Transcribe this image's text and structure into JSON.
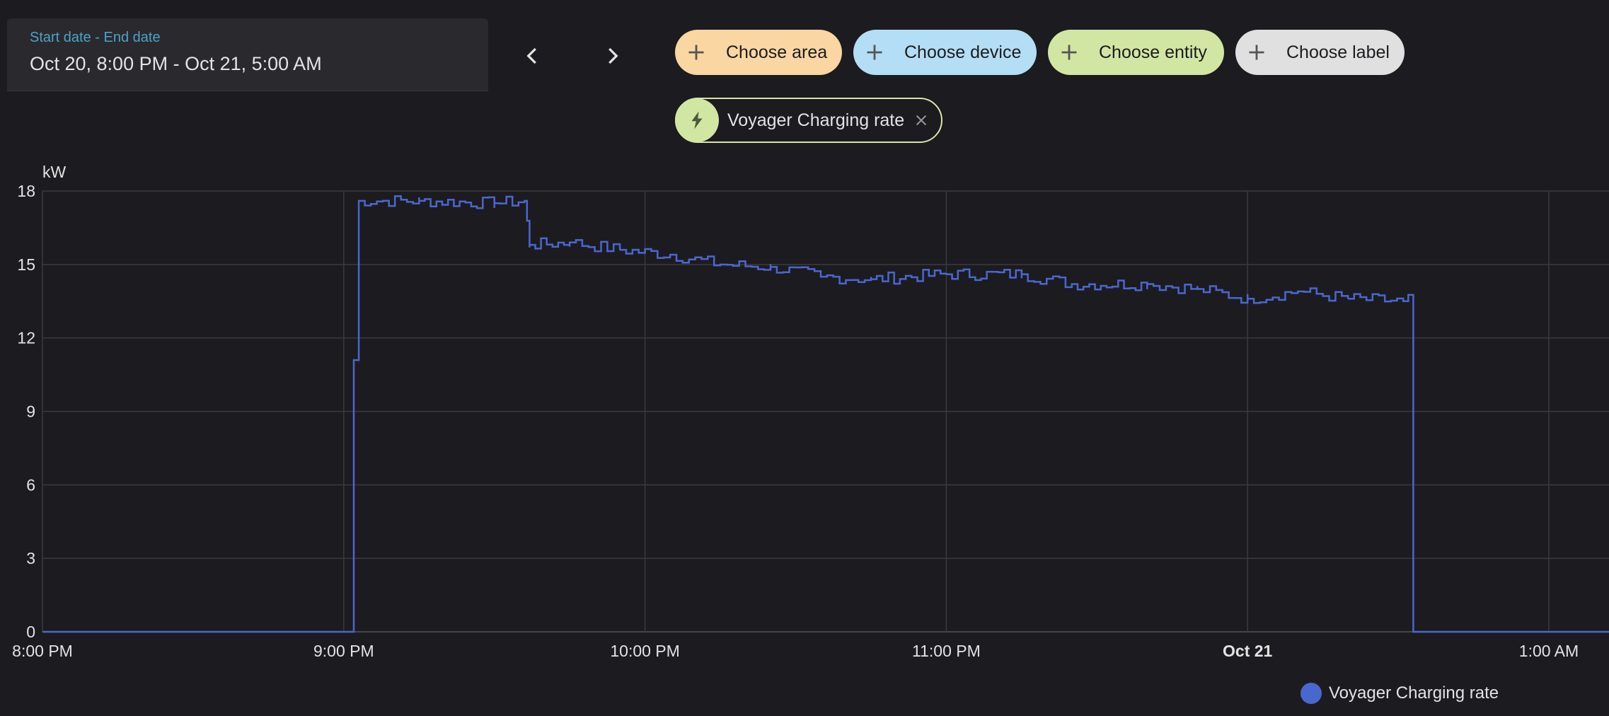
{
  "date_range": {
    "label": "Start date - End date",
    "value": "Oct 20, 8:00 PM - Oct 21, 5:00 AM"
  },
  "filters": {
    "area": {
      "label": "Choose area",
      "color": "#f9d6a2"
    },
    "device": {
      "label": "Choose device",
      "color": "#b3def5"
    },
    "entity": {
      "label": "Choose entity",
      "color": "#d2e6a3"
    },
    "label": {
      "label": "Choose label",
      "color": "#e0e0e0"
    }
  },
  "selected_entity": {
    "label": "Voyager Charging rate",
    "icon": "lightning-bolt-icon"
  },
  "legend": {
    "label": "Voyager Charging rate",
    "color": "#4a67cf"
  },
  "chart_data": {
    "type": "line",
    "step": true,
    "ylabel": "kW",
    "ylim": [
      0,
      18
    ],
    "yticks": [
      0,
      3,
      6,
      9,
      12,
      15,
      18
    ],
    "xlim_hours": [
      "8:00 PM",
      "1:12 AM"
    ],
    "xticks": [
      "8:00 PM",
      "9:00 PM",
      "10:00 PM",
      "11:00 PM",
      "Oct 21",
      "1:00 AM"
    ],
    "xticks_bold": [
      false,
      false,
      false,
      false,
      true,
      false
    ],
    "grid": true,
    "series": [
      {
        "name": "Voyager Charging rate",
        "color": "#4a67cf",
        "points": [
          [
            "8:00 PM",
            0
          ],
          [
            "9:02 PM",
            0
          ],
          [
            "9:02 PM",
            11.1
          ],
          [
            "9:03 PM",
            11.1
          ],
          [
            "9:03 PM",
            17.6
          ],
          [
            "9:15 PM",
            17.6
          ],
          [
            "9:30 PM",
            17.5
          ],
          [
            "9:36 PM",
            17.6
          ],
          [
            "9:37 PM",
            15.8
          ],
          [
            "9:45 PM",
            15.9
          ],
          [
            "9:55 PM",
            15.6
          ],
          [
            "10:05 PM",
            15.4
          ],
          [
            "10:15 PM",
            15.0
          ],
          [
            "10:25 PM",
            14.9
          ],
          [
            "10:35 PM",
            14.5
          ],
          [
            "10:45 PM",
            14.4
          ],
          [
            "11:00 PM",
            14.6
          ],
          [
            "11:15 PM",
            14.6
          ],
          [
            "11:25 PM",
            14.2
          ],
          [
            "11:40 PM",
            14.2
          ],
          [
            "11:50 PM",
            14.0
          ],
          [
            "12:00 AM",
            13.6
          ],
          [
            "12:10 AM",
            13.9
          ],
          [
            "12:20 AM",
            13.6
          ],
          [
            "12:31 AM",
            13.5
          ],
          [
            "12:33 AM",
            13.6
          ],
          [
            "12:33 AM",
            0
          ],
          [
            "1:12 AM",
            0
          ]
        ]
      }
    ]
  }
}
